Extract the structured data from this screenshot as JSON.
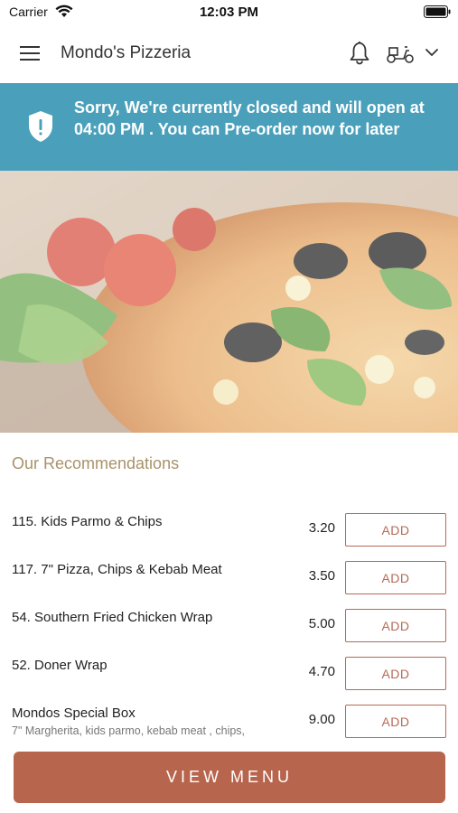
{
  "status_bar": {
    "carrier": "Carrier",
    "time": "12:03 PM"
  },
  "header": {
    "title": "Mondo's Pizzeria",
    "icons": [
      "menu-icon",
      "bell-icon",
      "scooter-icon",
      "chevron-down-icon"
    ]
  },
  "banner": {
    "message": "Sorry, We're currently closed and will open at 04:00 PM . You can Pre-order now for later",
    "icon": "shield-alert-icon",
    "color": "#4aa0bb"
  },
  "recommendations": {
    "title": "Our Recommendations",
    "items": [
      {
        "name": "115. Kids Parmo & Chips",
        "description": "",
        "price": "3.20",
        "action": "ADD"
      },
      {
        "name": "117. 7\" Pizza, Chips & Kebab Meat",
        "description": "",
        "price": "3.50",
        "action": "ADD"
      },
      {
        "name": "54. Southern Fried Chicken Wrap",
        "description": "",
        "price": "5.00",
        "action": "ADD"
      },
      {
        "name": "52. Doner Wrap",
        "description": "",
        "price": "4.70",
        "action": "ADD"
      },
      {
        "name": "Mondos Special Box",
        "description": "7\" Margherita, kids parmo, kebab meat , chips,",
        "price": "9.00",
        "action": "ADD"
      }
    ]
  },
  "footer": {
    "view_menu_label": "VIEW MENU"
  },
  "colors": {
    "accent": "#b8654e",
    "section_title": "#a9926a",
    "banner": "#4aa0bb"
  }
}
